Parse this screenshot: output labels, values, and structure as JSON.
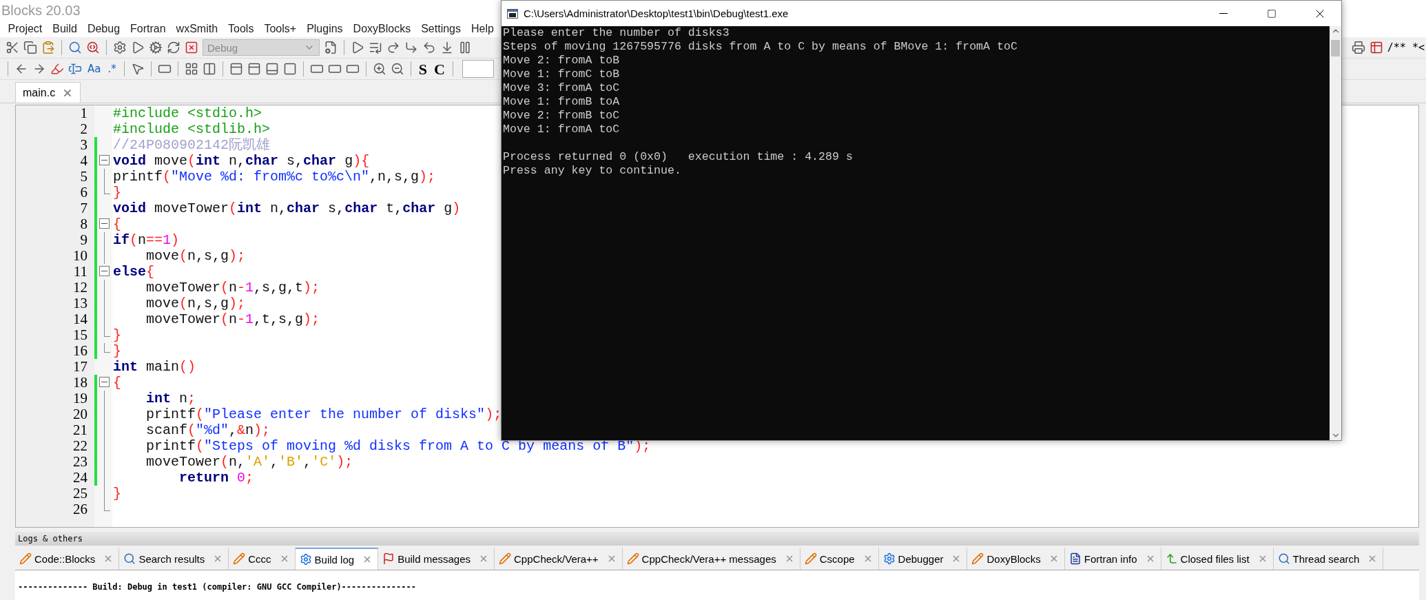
{
  "window": {
    "title": "Blocks 20.03"
  },
  "menu": [
    "Project",
    "Build",
    "Debug",
    "Fortran",
    "wxSmith",
    "Tools",
    "Tools+",
    "Plugins",
    "DoxyBlocks",
    "Settings",
    "Help"
  ],
  "toolbar": {
    "build_target": {
      "value": "Debug",
      "disabled": true
    },
    "glyph_buttons": [
      "Aa",
      ".*",
      "S",
      "C"
    ],
    "right_text": "/** *<"
  },
  "editor_tabs": [
    {
      "label": "main.c",
      "selected": true
    }
  ],
  "code_lines": [
    {
      "number": "1",
      "changed": false,
      "kind": "plain",
      "tokens": [
        {
          "kind": "pp",
          "text": "#include <stdio.h>"
        }
      ]
    },
    {
      "number": "2",
      "changed": false,
      "kind": "plain",
      "tokens": [
        {
          "kind": "pp",
          "text": "#include <stdlib.h>"
        }
      ]
    },
    {
      "number": "3",
      "changed": true,
      "kind": "plain",
      "tokens": [
        {
          "kind": "cmt",
          "text": "//24P080902142阮凯雄"
        }
      ]
    },
    {
      "number": "4",
      "changed": true,
      "kind": "fold-start",
      "tokens": [
        {
          "kind": "kw",
          "text": "void"
        },
        {
          "kind": "id",
          "text": " move"
        },
        {
          "kind": "op",
          "text": "("
        },
        {
          "kind": "kw",
          "text": "int"
        },
        {
          "kind": "id",
          "text": " n,"
        },
        {
          "kind": "kw",
          "text": "char"
        },
        {
          "kind": "id",
          "text": " s,"
        },
        {
          "kind": "kw",
          "text": "char"
        },
        {
          "kind": "id",
          "text": " g"
        },
        {
          "kind": "op",
          "text": "){"
        }
      ]
    },
    {
      "number": "5",
      "changed": true,
      "kind": "fold-body",
      "tokens": [
        {
          "kind": "id",
          "text": "printf"
        },
        {
          "kind": "op",
          "text": "("
        },
        {
          "kind": "str",
          "text": "\"Move %d: from%c to%c\\n\""
        },
        {
          "kind": "id",
          "text": ",n,s,g"
        },
        {
          "kind": "op",
          "text": ");"
        }
      ]
    },
    {
      "number": "6",
      "changed": true,
      "kind": "fold-end",
      "tokens": [
        {
          "kind": "op",
          "text": "}"
        }
      ]
    },
    {
      "number": "7",
      "changed": true,
      "kind": "plain",
      "tokens": [
        {
          "kind": "kw",
          "text": "void"
        },
        {
          "kind": "id",
          "text": " moveTower"
        },
        {
          "kind": "op",
          "text": "("
        },
        {
          "kind": "kw",
          "text": "int"
        },
        {
          "kind": "id",
          "text": " n,"
        },
        {
          "kind": "kw",
          "text": "char"
        },
        {
          "kind": "id",
          "text": " s,"
        },
        {
          "kind": "kw",
          "text": "char"
        },
        {
          "kind": "id",
          "text": " t,"
        },
        {
          "kind": "kw",
          "text": "char"
        },
        {
          "kind": "id",
          "text": " g"
        },
        {
          "kind": "op",
          "text": ")"
        }
      ]
    },
    {
      "number": "8",
      "changed": true,
      "kind": "fold-start",
      "tokens": [
        {
          "kind": "op",
          "text": "{"
        }
      ]
    },
    {
      "number": "9",
      "changed": true,
      "kind": "fold-body",
      "tokens": [
        {
          "kind": "kw",
          "text": "if"
        },
        {
          "kind": "op",
          "text": "("
        },
        {
          "kind": "id",
          "text": "n"
        },
        {
          "kind": "op",
          "text": "=="
        },
        {
          "kind": "num",
          "text": "1"
        },
        {
          "kind": "op",
          "text": ")"
        }
      ]
    },
    {
      "number": "10",
      "changed": true,
      "kind": "fold-body",
      "tokens": [
        {
          "kind": "id",
          "text": "    move"
        },
        {
          "kind": "op",
          "text": "("
        },
        {
          "kind": "id",
          "text": "n,s,g"
        },
        {
          "kind": "op",
          "text": ");"
        }
      ]
    },
    {
      "number": "11",
      "changed": true,
      "kind": "fold-start",
      "tokens": [
        {
          "kind": "kw",
          "text": "else"
        },
        {
          "kind": "op",
          "text": "{"
        }
      ]
    },
    {
      "number": "12",
      "changed": true,
      "kind": "fold-body",
      "tokens": [
        {
          "kind": "id",
          "text": "    moveTower"
        },
        {
          "kind": "op",
          "text": "("
        },
        {
          "kind": "id",
          "text": "n"
        },
        {
          "kind": "op",
          "text": "-"
        },
        {
          "kind": "num",
          "text": "1"
        },
        {
          "kind": "id",
          "text": ",s,g,t"
        },
        {
          "kind": "op",
          "text": ");"
        }
      ]
    },
    {
      "number": "13",
      "changed": true,
      "kind": "fold-body",
      "tokens": [
        {
          "kind": "id",
          "text": "    move"
        },
        {
          "kind": "op",
          "text": "("
        },
        {
          "kind": "id",
          "text": "n,s,g"
        },
        {
          "kind": "op",
          "text": ");"
        }
      ]
    },
    {
      "number": "14",
      "changed": true,
      "kind": "fold-body",
      "tokens": [
        {
          "kind": "id",
          "text": "    moveTower"
        },
        {
          "kind": "op",
          "text": "("
        },
        {
          "kind": "id",
          "text": "n"
        },
        {
          "kind": "op",
          "text": "-"
        },
        {
          "kind": "num",
          "text": "1"
        },
        {
          "kind": "id",
          "text": ",t,s,g"
        },
        {
          "kind": "op",
          "text": ");"
        }
      ]
    },
    {
      "number": "15",
      "changed": true,
      "kind": "fold-end",
      "tokens": [
        {
          "kind": "op",
          "text": "}"
        }
      ]
    },
    {
      "number": "16",
      "changed": true,
      "kind": "fold-end",
      "tokens": [
        {
          "kind": "op",
          "text": "}"
        }
      ]
    },
    {
      "number": "17",
      "changed": false,
      "kind": "plain",
      "tokens": [
        {
          "kind": "kw",
          "text": "int"
        },
        {
          "kind": "id",
          "text": " main"
        },
        {
          "kind": "op",
          "text": "()"
        }
      ]
    },
    {
      "number": "18",
      "changed": true,
      "kind": "fold-start",
      "tokens": [
        {
          "kind": "op",
          "text": "{"
        }
      ]
    },
    {
      "number": "19",
      "changed": true,
      "kind": "fold-body",
      "tokens": [
        {
          "kind": "kw",
          "text": "    int"
        },
        {
          "kind": "id",
          "text": " n"
        },
        {
          "kind": "op",
          "text": ";"
        }
      ]
    },
    {
      "number": "20",
      "changed": true,
      "kind": "fold-body",
      "tokens": [
        {
          "kind": "id",
          "text": "    printf"
        },
        {
          "kind": "op",
          "text": "("
        },
        {
          "kind": "str",
          "text": "\"Please enter the number of disks\""
        },
        {
          "kind": "op",
          "text": ");"
        }
      ]
    },
    {
      "number": "21",
      "changed": true,
      "kind": "fold-body",
      "tokens": [
        {
          "kind": "id",
          "text": "    scanf"
        },
        {
          "kind": "op",
          "text": "("
        },
        {
          "kind": "str",
          "text": "\"%d\""
        },
        {
          "kind": "id",
          "text": ","
        },
        {
          "kind": "op",
          "text": "&"
        },
        {
          "kind": "id",
          "text": "n"
        },
        {
          "kind": "op",
          "text": ");"
        }
      ]
    },
    {
      "number": "22",
      "changed": true,
      "kind": "fold-body",
      "tokens": [
        {
          "kind": "id",
          "text": "    printf"
        },
        {
          "kind": "op",
          "text": "("
        },
        {
          "kind": "str",
          "text": "\"Steps of moving %d disks from A to C by means of B\""
        },
        {
          "kind": "op",
          "text": ");"
        }
      ]
    },
    {
      "number": "23",
      "changed": true,
      "kind": "fold-body",
      "tokens": [
        {
          "kind": "id",
          "text": "    moveTower"
        },
        {
          "kind": "op",
          "text": "("
        },
        {
          "kind": "id",
          "text": "n,"
        },
        {
          "kind": "chr",
          "text": "'A'"
        },
        {
          "kind": "id",
          "text": ","
        },
        {
          "kind": "chr",
          "text": "'B'"
        },
        {
          "kind": "id",
          "text": ","
        },
        {
          "kind": "chr",
          "text": "'C'"
        },
        {
          "kind": "op",
          "text": ");"
        }
      ]
    },
    {
      "number": "24",
      "changed": true,
      "kind": "fold-body",
      "tokens": [
        {
          "kind": "kw",
          "text": "        return"
        },
        {
          "kind": "num",
          "text": " 0"
        },
        {
          "kind": "op",
          "text": ";"
        }
      ]
    },
    {
      "number": "25",
      "changed": false,
      "kind": "fold-body",
      "tokens": [
        {
          "kind": "op",
          "text": "}"
        }
      ]
    },
    {
      "number": "26",
      "changed": false,
      "kind": "fold-end"
    }
  ],
  "logs": {
    "title": "Logs & others",
    "tabs": [
      {
        "label": "Code::Blocks",
        "selected": false
      },
      {
        "label": "Search results",
        "selected": false
      },
      {
        "label": "Cccc",
        "selected": false
      },
      {
        "label": "Build log",
        "selected": true
      },
      {
        "label": "Build messages",
        "selected": false
      },
      {
        "label": "CppCheck/Vera++",
        "selected": false
      },
      {
        "label": "CppCheck/Vera++ messages",
        "selected": false
      },
      {
        "label": "Cscope",
        "selected": false
      },
      {
        "label": "Debugger",
        "selected": false
      },
      {
        "label": "DoxyBlocks",
        "selected": false
      },
      {
        "label": "Fortran info",
        "selected": false
      },
      {
        "label": "Closed files list",
        "selected": false
      },
      {
        "label": "Thread search",
        "selected": false
      }
    ],
    "text": "-------------- Build: Debug in test1 (compiler: GNU GCC Compiler)---------------"
  },
  "console": {
    "title": "C:\\Users\\Administrator\\Desktop\\test1\\bin\\Debug\\test1.exe",
    "blocks": [
      [
        "Please enter the number of disks3",
        "Steps of moving 1267595776 disks from A to C by means of BMove 1: fromA toC",
        "Move 2: fromA toB",
        "Move 1: fromC toB",
        "Move 3: fromA toC",
        "Move 1: fromB toA",
        "Move 2: fromB toC",
        "Move 1: fromA toC"
      ],
      [
        "Process returned 0 (0x0)   execution time : 4.289 s",
        "Press any key to continue."
      ]
    ]
  }
}
